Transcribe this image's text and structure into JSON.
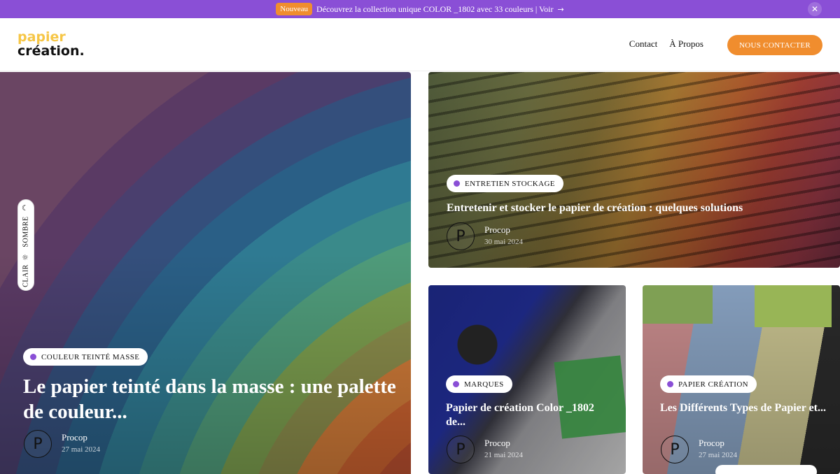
{
  "announcement": {
    "badge": "Nouveau",
    "message": "Découvrez la collection unique COLOR _1802 avec 33 couleurs | Voir",
    "arrow_icon": "→",
    "close_icon": "✕"
  },
  "header": {
    "logo_line1": "papier",
    "logo_line2": "création.",
    "nav": [
      "Contact",
      "À Propos"
    ],
    "cta": "NOUS CONTACTER"
  },
  "theme_switch": {
    "dark_label": "SOMBRE",
    "light_label": "CLAIR",
    "moon_icon": "☾",
    "sun_icon": "☼"
  },
  "articles": [
    {
      "tag": "COULEUR TEINTÉ MASSE",
      "title": "Le papier teinté dans la masse : une palette de couleur...",
      "author": "Procop",
      "date": "27 mai 2024",
      "avatar": "P"
    },
    {
      "tag": "ENTRETIEN STOCKAGE",
      "title": "Entretenir et stocker le papier de création : quelques solutions",
      "author": "Procop",
      "date": "30 mai 2024",
      "avatar": "P"
    },
    {
      "tag": "MARQUES",
      "title": "Papier de création Color _1802 de...",
      "author": "Procop",
      "date": "21 mai 2024",
      "avatar": "P"
    },
    {
      "tag": "PAPIER CRÉATION",
      "title": "Les Différents Types de Papier et...",
      "author": "Procop",
      "date": "27 mai 2024",
      "avatar": "P"
    }
  ],
  "colors": {
    "accent_purple": "#8a4fd6",
    "accent_orange": "#f08d2e",
    "logo_yellow": "#f6c646"
  }
}
